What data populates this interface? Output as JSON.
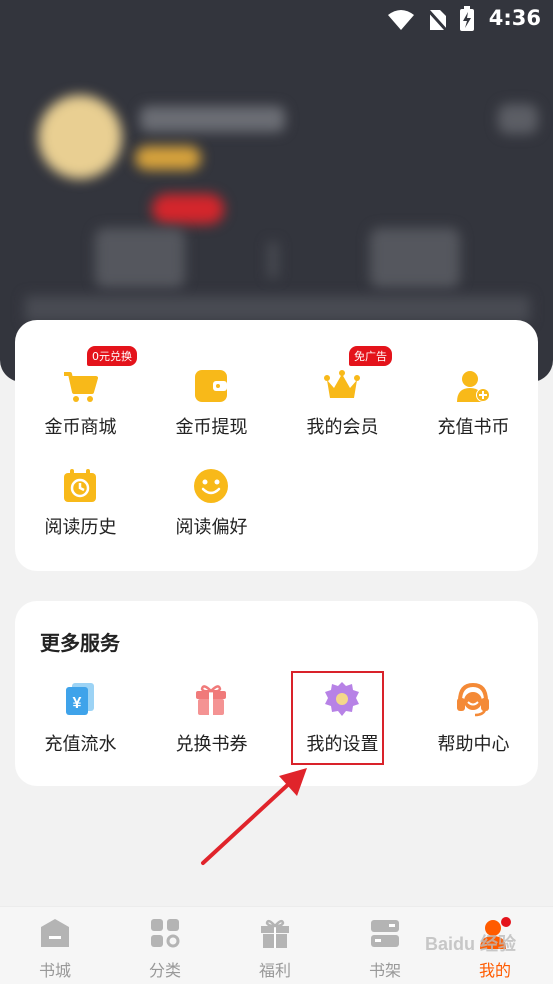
{
  "status_bar": {
    "time": "4:36"
  },
  "quick_grid": {
    "items": [
      {
        "label": "金币商城",
        "tag": "0元兑换",
        "icon": "cart-icon"
      },
      {
        "label": "金币提现",
        "icon": "wallet-icon"
      },
      {
        "label": "我的会员",
        "tag": "免广告",
        "icon": "crown-icon"
      },
      {
        "label": "充值书币",
        "icon": "add-user-icon"
      },
      {
        "label": "阅读历史",
        "icon": "calendar-history-icon"
      },
      {
        "label": "阅读偏好",
        "icon": "smile-icon"
      }
    ]
  },
  "more_services": {
    "title": "更多服务",
    "items": [
      {
        "label": "充值流水",
        "icon": "yuan-card-icon"
      },
      {
        "label": "兑换书券",
        "icon": "gift-icon"
      },
      {
        "label": "我的设置",
        "icon": "gear-icon"
      },
      {
        "label": "帮助中心",
        "icon": "headset-icon"
      }
    ]
  },
  "tabbar": {
    "tabs": [
      {
        "label": "书城",
        "icon": "store-icon"
      },
      {
        "label": "分类",
        "icon": "category-icon"
      },
      {
        "label": "福利",
        "icon": "gift-icon"
      },
      {
        "label": "书架",
        "icon": "bookshelf-icon"
      },
      {
        "label": "我的",
        "icon": "profile-icon",
        "active": true
      }
    ]
  },
  "watermark": "Baidu 经验",
  "colors": {
    "accent": "#ff5b00",
    "icon_yellow": "#f8b919",
    "tag_red": "#e4131b",
    "header_bg": "#33353d",
    "highlight": "#d9222a"
  }
}
